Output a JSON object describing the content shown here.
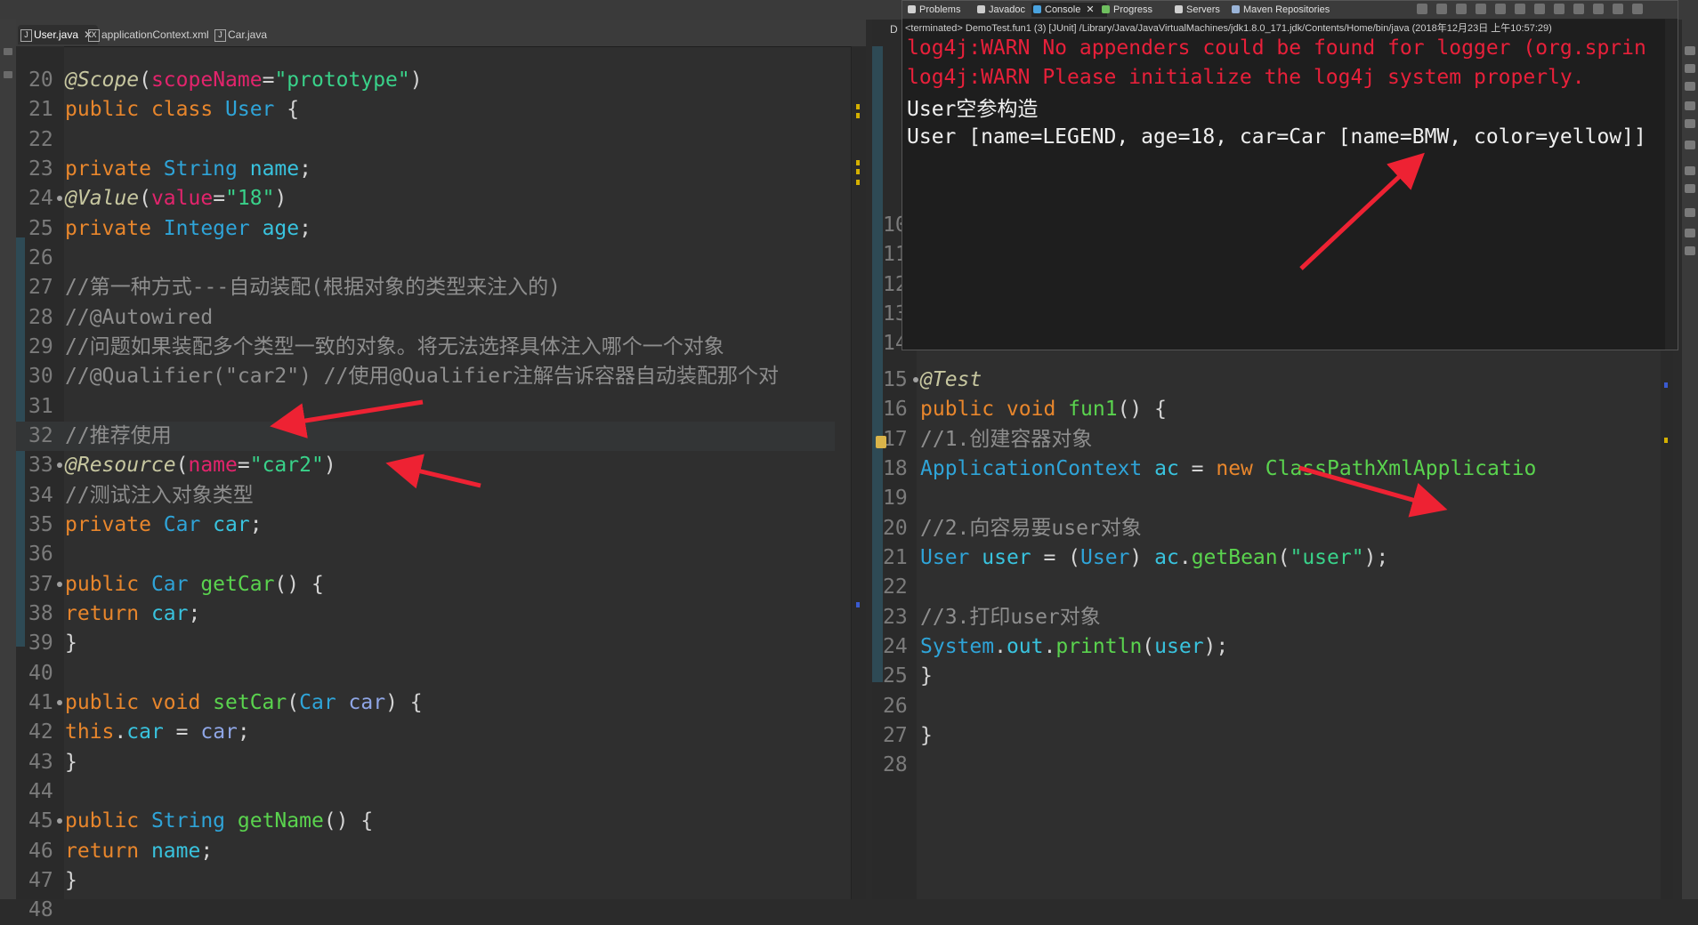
{
  "editor_left": {
    "tabs": [
      {
        "label": "User.java",
        "icon": "java-file-icon",
        "active": true,
        "closable": true
      },
      {
        "label": "applicationContext.xml",
        "icon": "xml-file-icon",
        "active": false,
        "closable": false
      },
      {
        "label": "Car.java",
        "icon": "java-file-icon",
        "active": false,
        "closable": false
      }
    ],
    "lines": [
      {
        "n": "20",
        "parts": [
          [
            "an",
            "@Scope"
          ],
          [
            "p",
            "("
          ],
          [
            "pm",
            "scopeName"
          ],
          [
            "p",
            "="
          ],
          [
            "st",
            "\"prototype\""
          ],
          [
            "p",
            ")"
          ]
        ]
      },
      {
        "n": "21",
        "parts": [
          [
            "kw",
            "public class "
          ],
          [
            "ty",
            "User"
          ],
          [
            "p",
            " {"
          ]
        ]
      },
      {
        "n": "22",
        "parts": []
      },
      {
        "n": "23",
        "parts": [
          [
            "p",
            "    "
          ],
          [
            "kw",
            "private "
          ],
          [
            "ty",
            "String "
          ],
          [
            "fd",
            "name"
          ],
          [
            "p",
            ";"
          ]
        ]
      },
      {
        "n": "24",
        "fold": true,
        "parts": [
          [
            "p",
            "    "
          ],
          [
            "an",
            "@Value"
          ],
          [
            "p",
            "("
          ],
          [
            "pm",
            "value"
          ],
          [
            "p",
            "="
          ],
          [
            "st",
            "\"18\""
          ],
          [
            "p",
            ")"
          ]
        ]
      },
      {
        "n": "25",
        "parts": [
          [
            "p",
            "    "
          ],
          [
            "kw",
            "private "
          ],
          [
            "ty",
            "Integer "
          ],
          [
            "fd",
            "age"
          ],
          [
            "p",
            ";"
          ]
        ]
      },
      {
        "n": "26",
        "parts": []
      },
      {
        "n": "27",
        "parts": [
          [
            "p",
            "    "
          ],
          [
            "cm",
            "//第一种方式---自动装配(根据对象的类型来注入的)"
          ]
        ]
      },
      {
        "n": "28",
        "parts": [
          [
            "p",
            "    "
          ],
          [
            "cm",
            "//@Autowired"
          ]
        ]
      },
      {
        "n": "29",
        "parts": [
          [
            "p",
            "    "
          ],
          [
            "cm",
            "//问题如果装配多个类型一致的对象。将无法选择具体注入哪个一个对象"
          ]
        ]
      },
      {
        "n": "30",
        "parts": [
          [
            "p",
            "    "
          ],
          [
            "cm",
            "//@Qualifier(\"car2\") //使用@Qualifier注解告诉容器自动装配那个对"
          ]
        ]
      },
      {
        "n": "31",
        "parts": []
      },
      {
        "n": "32",
        "hl": true,
        "parts": [
          [
            "p",
            "    "
          ],
          [
            "cm",
            "//推荐使用"
          ]
        ]
      },
      {
        "n": "33",
        "fold": true,
        "parts": [
          [
            "p",
            "    "
          ],
          [
            "an",
            "@Resource"
          ],
          [
            "p",
            "("
          ],
          [
            "pm",
            "name"
          ],
          [
            "p",
            "="
          ],
          [
            "st",
            "\"car2\""
          ],
          [
            "p",
            ")"
          ]
        ]
      },
      {
        "n": "34",
        "parts": [
          [
            "p",
            "    "
          ],
          [
            "cm",
            "//测试注入对象类型"
          ]
        ]
      },
      {
        "n": "35",
        "parts": [
          [
            "p",
            "    "
          ],
          [
            "kw",
            "private "
          ],
          [
            "ty",
            "Car "
          ],
          [
            "fd",
            "car"
          ],
          [
            "p",
            ";"
          ]
        ]
      },
      {
        "n": "36",
        "parts": []
      },
      {
        "n": "37",
        "fold": true,
        "parts": [
          [
            "p",
            "    "
          ],
          [
            "kw",
            "public "
          ],
          [
            "ty",
            "Car "
          ],
          [
            "mt",
            "getCar"
          ],
          [
            "p",
            "() {"
          ]
        ]
      },
      {
        "n": "38",
        "parts": [
          [
            "p",
            "        "
          ],
          [
            "kw",
            "return "
          ],
          [
            "fd",
            "car"
          ],
          [
            "p",
            ";"
          ]
        ]
      },
      {
        "n": "39",
        "parts": [
          [
            "p",
            "    }"
          ]
        ]
      },
      {
        "n": "40",
        "parts": []
      },
      {
        "n": "41",
        "fold": true,
        "parts": [
          [
            "p",
            "    "
          ],
          [
            "kw",
            "public void "
          ],
          [
            "mt",
            "setCar"
          ],
          [
            "p",
            "("
          ],
          [
            "ty",
            "Car "
          ],
          [
            "pa",
            "car"
          ],
          [
            "p",
            ") {"
          ]
        ]
      },
      {
        "n": "42",
        "parts": [
          [
            "p",
            "        "
          ],
          [
            "kw",
            "this"
          ],
          [
            "p",
            "."
          ],
          [
            "fd",
            "car"
          ],
          [
            "p",
            " = "
          ],
          [
            "pa",
            "car"
          ],
          [
            "p",
            ";"
          ]
        ]
      },
      {
        "n": "43",
        "parts": [
          [
            "p",
            "    }"
          ]
        ]
      },
      {
        "n": "44",
        "parts": []
      },
      {
        "n": "45",
        "fold": true,
        "parts": [
          [
            "p",
            "    "
          ],
          [
            "kw",
            "public "
          ],
          [
            "ty",
            "String "
          ],
          [
            "mt",
            "getName"
          ],
          [
            "p",
            "() {"
          ]
        ]
      },
      {
        "n": "46",
        "parts": [
          [
            "p",
            "        "
          ],
          [
            "kw",
            "return "
          ],
          [
            "fd",
            "name"
          ],
          [
            "p",
            ";"
          ]
        ]
      },
      {
        "n": "47",
        "parts": [
          [
            "p",
            "    }"
          ]
        ]
      },
      {
        "n": "48",
        "parts": []
      }
    ]
  },
  "editor_right": {
    "tab_letter": "D",
    "hidden_line_numbers": [
      "10",
      "11",
      "12",
      "13",
      "14"
    ],
    "lines": [
      {
        "n": "15",
        "fold": true,
        "parts": [
          [
            "p",
            "    "
          ],
          [
            "an",
            "@Test"
          ]
        ]
      },
      {
        "n": "16",
        "parts": [
          [
            "p",
            "    "
          ],
          [
            "kw",
            "public void "
          ],
          [
            "mt",
            "fun1"
          ],
          [
            "p",
            "() {"
          ]
        ]
      },
      {
        "n": "17",
        "parts": [
          [
            "p",
            "        "
          ],
          [
            "cm",
            "//1.创建容器对象"
          ]
        ]
      },
      {
        "n": "18",
        "parts": [
          [
            "p",
            "        "
          ],
          [
            "ty",
            "ApplicationContext "
          ],
          [
            "fd",
            "ac"
          ],
          [
            "p",
            " = "
          ],
          [
            "kw",
            "new "
          ],
          [
            "mt",
            "ClassPathXmlApplicatio"
          ]
        ]
      },
      {
        "n": "19",
        "parts": []
      },
      {
        "n": "20",
        "parts": [
          [
            "p",
            "        "
          ],
          [
            "cm",
            "//2.向容易要user对象"
          ]
        ]
      },
      {
        "n": "21",
        "parts": [
          [
            "p",
            "        "
          ],
          [
            "ty",
            "User "
          ],
          [
            "fd",
            "user"
          ],
          [
            "p",
            " = ("
          ],
          [
            "ty",
            "User"
          ],
          [
            "p",
            ") "
          ],
          [
            "fd",
            "ac"
          ],
          [
            "p",
            "."
          ],
          [
            "mt",
            "getBean"
          ],
          [
            "p",
            "("
          ],
          [
            "st",
            "\"user\""
          ],
          [
            "p",
            ");"
          ]
        ]
      },
      {
        "n": "22",
        "parts": []
      },
      {
        "n": "23",
        "parts": [
          [
            "p",
            "        "
          ],
          [
            "cm",
            "//3.打印user对象"
          ]
        ]
      },
      {
        "n": "24",
        "parts": [
          [
            "p",
            "        "
          ],
          [
            "ty",
            "System"
          ],
          [
            "p",
            "."
          ],
          [
            "fd",
            "out"
          ],
          [
            "p",
            "."
          ],
          [
            "mt",
            "println"
          ],
          [
            "p",
            "("
          ],
          [
            "fd",
            "user"
          ],
          [
            "p",
            ");"
          ]
        ]
      },
      {
        "n": "25",
        "parts": [
          [
            "p",
            "    }"
          ]
        ]
      },
      {
        "n": "26",
        "parts": []
      },
      {
        "n": "27",
        "parts": [
          [
            "p",
            "}"
          ]
        ]
      },
      {
        "n": "28",
        "parts": []
      }
    ]
  },
  "console": {
    "tabs": [
      {
        "label": "Problems",
        "icon": "problems-icon",
        "color": "#d0d0d0",
        "active": false
      },
      {
        "label": "Javadoc",
        "icon": "javadoc-icon",
        "color": "#cccccc",
        "active": false
      },
      {
        "label": "Console",
        "icon": "console-icon",
        "color": "#4aa3df",
        "active": true
      },
      {
        "label": "Progress",
        "icon": "progress-icon",
        "color": "#6fbf5f",
        "active": false
      },
      {
        "label": "Servers",
        "icon": "servers-icon",
        "color": "#cfcfcf",
        "active": false
      },
      {
        "label": "Maven Repositories",
        "icon": "maven-icon",
        "color": "#9ab4d8",
        "active": false
      }
    ],
    "close_glyph": "✕",
    "terminated_line": "<terminated> DemoTest.fun1 (3) [JUnit] /Library/Java/JavaVirtualMachines/jdk1.8.0_171.jdk/Contents/Home/bin/java (2018年12月23日 上午10:57:29)",
    "output": [
      {
        "text": "log4j:WARN No appenders could be found for logger (org.sprin",
        "kind": "warn"
      },
      {
        "text": "log4j:WARN Please initialize the log4j system properly.",
        "kind": "warn"
      },
      {
        "text": "User空参构造",
        "kind": "out"
      },
      {
        "text": "User [name=LEGEND, age=18, car=Car [name=BMW, color=yellow]]",
        "kind": "out"
      }
    ]
  },
  "colors": {
    "background": "#2b2b2b",
    "arrow": "#ee2233",
    "keyword": "#e8862c",
    "type": "#2fa4d8",
    "string": "#39d28a",
    "warn": "#e8203a"
  }
}
